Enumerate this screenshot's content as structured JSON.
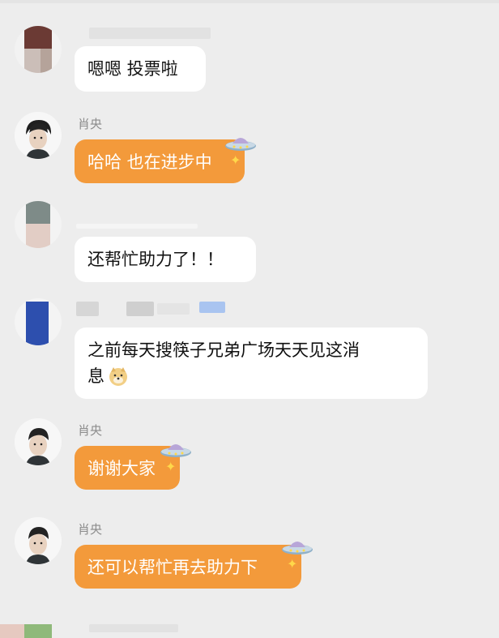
{
  "messages": [
    {
      "id": 1,
      "sender": "",
      "text": "嗯嗯 投票啦",
      "style": "white"
    },
    {
      "id": 2,
      "sender": "肖央",
      "text": "哈哈 也在进步中",
      "style": "orange"
    },
    {
      "id": 3,
      "sender": "",
      "text": "还帮忙助力了！！",
      "style": "white"
    },
    {
      "id": 4,
      "sender": "",
      "text_line1": "之前每天搜筷子兄弟广场天天见这消",
      "text_line2": "息",
      "style": "white",
      "emoji_icon": "doge-icon"
    },
    {
      "id": 5,
      "sender": "肖央",
      "text": "谢谢大家",
      "style": "orange"
    },
    {
      "id": 6,
      "sender": "肖央",
      "text": "还可以帮忙再去助力下",
      "style": "orange"
    }
  ],
  "colors": {
    "background": "#ededed",
    "bubble_white": "#ffffff",
    "bubble_orange": "#f39a3b",
    "sender_text": "#8c8c8c"
  },
  "icons": [
    "ufo-sticker-icon",
    "sparkle-icon",
    "doge-icon",
    "avatar"
  ]
}
